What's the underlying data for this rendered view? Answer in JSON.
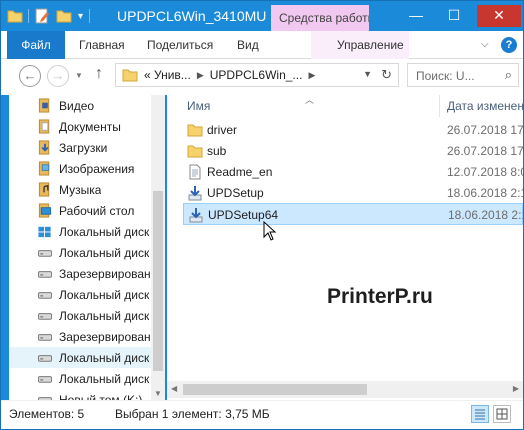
{
  "window": {
    "title": "UPDPCL6Win_3410MU",
    "context_tab": "Средства работы с ...",
    "controls": {
      "minimize": "—",
      "maximize": "☐",
      "close": "✕"
    }
  },
  "ribbon": {
    "file_tab": "Файл",
    "tabs": [
      "Главная",
      "Поделиться",
      "Вид",
      "Управление"
    ],
    "help": "?"
  },
  "address": {
    "back": "←",
    "forward": "→",
    "up": "↑",
    "segments": [
      "« Унив...",
      "UPDPCL6Win_..."
    ],
    "search_placeholder": "Поиск: U..."
  },
  "sidebar": {
    "items": [
      {
        "label": "Видео",
        "icon": "video-library-icon"
      },
      {
        "label": "Документы",
        "icon": "documents-library-icon"
      },
      {
        "label": "Загрузки",
        "icon": "downloads-folder-icon"
      },
      {
        "label": "Изображения",
        "icon": "pictures-library-icon"
      },
      {
        "label": "Музыка",
        "icon": "music-library-icon"
      },
      {
        "label": "Рабочий стол",
        "icon": "desktop-folder-icon"
      },
      {
        "label": "Локальный диск",
        "icon": "windows-drive-icon"
      },
      {
        "label": "Локальный диск",
        "icon": "drive-icon"
      },
      {
        "label": "Зарезервировано",
        "icon": "drive-icon"
      },
      {
        "label": "Локальный диск",
        "icon": "drive-icon"
      },
      {
        "label": "Локальный диск",
        "icon": "drive-icon"
      },
      {
        "label": "Зарезервировано",
        "icon": "drive-icon"
      },
      {
        "label": "Локальный диск",
        "icon": "drive-icon"
      },
      {
        "label": "Локальный диск",
        "icon": "drive-icon"
      },
      {
        "label": "Новый том (K:)",
        "icon": "drive-icon"
      }
    ],
    "selected_index": 12
  },
  "files": {
    "columns": {
      "name": "Имя",
      "date": "Дата изменен"
    },
    "rows": [
      {
        "name": "driver",
        "date": "26.07.2018 17",
        "type": "folder"
      },
      {
        "name": "sub",
        "date": "26.07.2018 17",
        "type": "folder"
      },
      {
        "name": "Readme_en",
        "date": "12.07.2018 8:0",
        "type": "document"
      },
      {
        "name": "UPDSetup",
        "date": "18.06.2018 2:1",
        "type": "installer"
      },
      {
        "name": "UPDSetup64",
        "date": "18.06.2018 2:1",
        "type": "installer"
      }
    ],
    "selected_index": 4
  },
  "watermark": "PrinterP.ru",
  "status": {
    "count": "Элементов: 5",
    "selection": "Выбран 1 элемент: 3,75 МБ"
  },
  "colors": {
    "titlebar": "#1b8ad8",
    "file_tab": "#1979ca",
    "context_tab": "#f0c8f0",
    "selection": "#cce8ff",
    "folder": "#e8b63a"
  }
}
